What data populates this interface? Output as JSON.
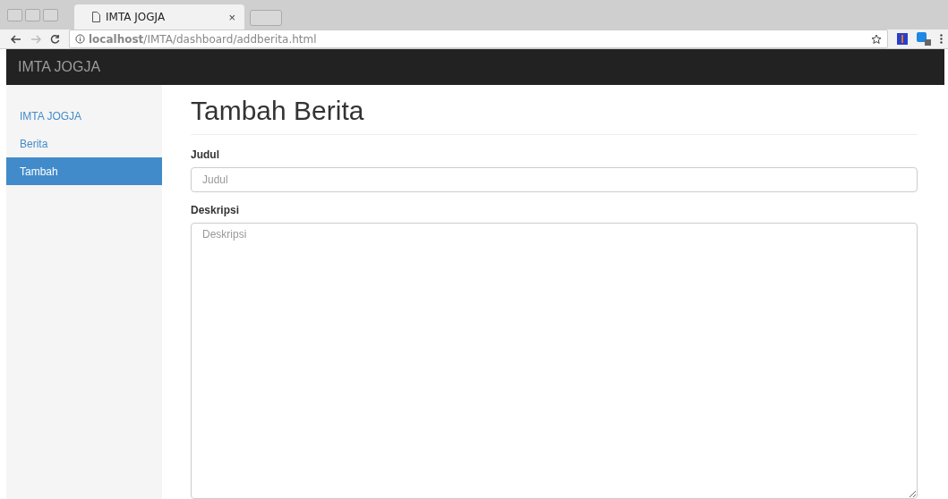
{
  "browser": {
    "tab_title": "IMTA JOGJA",
    "tab_close": "×",
    "url": "**localhost**/IMTA/dashboard/addberita.html"
  },
  "navbar": {
    "brand": "IMTA JOGJA"
  },
  "sidebar": {
    "items": [
      {
        "label": "IMTA JOGJA",
        "selected": false
      },
      {
        "label": "Berita",
        "selected": false
      },
      {
        "label": "Tambah",
        "selected": true
      }
    ]
  },
  "page": {
    "title": "Tambah Berita",
    "fields": [
      {
        "kind": "input",
        "label": "Judul",
        "placeholder": "Judul"
      },
      {
        "kind": "textarea",
        "label": "Deskripsi",
        "placeholder": "Deskripsi"
      }
    ]
  }
}
